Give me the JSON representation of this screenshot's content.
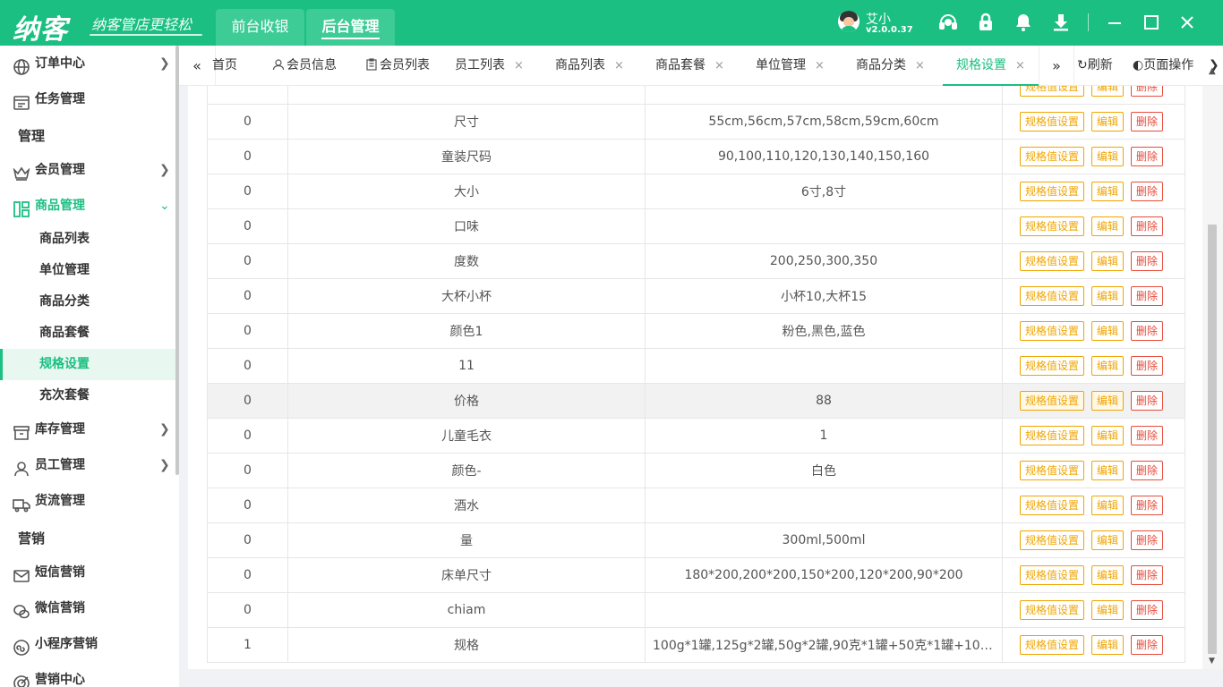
{
  "header": {
    "logo": "纳客",
    "slogan": "纳客管店更轻松",
    "tabs": [
      {
        "label": "前台收银"
      },
      {
        "label": "后台管理"
      }
    ],
    "user_name": "艾小",
    "version": "v2.0.0.37",
    "icons": [
      "headset-icon",
      "lock-icon",
      "bell-icon",
      "download-icon",
      "minimize-icon",
      "maximize-icon",
      "close-icon"
    ]
  },
  "sidebar": {
    "items": [
      {
        "label": "订单中心"
      },
      {
        "label": "任务管理"
      },
      {
        "group": "管理"
      },
      {
        "label": "会员管理"
      },
      {
        "label": "商品管理"
      },
      {
        "label": "库存管理"
      },
      {
        "label": "员工管理"
      },
      {
        "label": "货流管理"
      },
      {
        "group": "营销"
      },
      {
        "label": "短信营销"
      },
      {
        "label": "微信营销"
      },
      {
        "label": "小程序营销"
      },
      {
        "label": "营销中心"
      }
    ],
    "sub_items": [
      {
        "label": "商品列表"
      },
      {
        "label": "单位管理"
      },
      {
        "label": "商品分类"
      },
      {
        "label": "商品套餐"
      },
      {
        "label": "规格设置"
      },
      {
        "label": "充次套餐"
      }
    ]
  },
  "tabbar": {
    "tabs": [
      {
        "label": "首页"
      },
      {
        "label": "会员信息"
      },
      {
        "label": "会员列表"
      },
      {
        "label": "员工列表"
      },
      {
        "label": "商品列表"
      },
      {
        "label": "商品套餐"
      },
      {
        "label": "单位管理"
      },
      {
        "label": "商品分类"
      },
      {
        "label": "规格设置"
      }
    ],
    "refresh": "刷新",
    "page_ops": "页面操作",
    "close_glyph": "×"
  },
  "table": {
    "actions": {
      "spec": "规格值设置",
      "edit": "编辑",
      "del": "删除"
    },
    "rows": [
      {
        "sort": "0",
        "name": "尺寸",
        "values": "55cm,56cm,57cm,58cm,59cm,60cm"
      },
      {
        "sort": "0",
        "name": "童装尺码",
        "values": "90,100,110,120,130,140,150,160"
      },
      {
        "sort": "0",
        "name": "大小",
        "values": "6寸,8寸"
      },
      {
        "sort": "0",
        "name": "口味",
        "values": ""
      },
      {
        "sort": "0",
        "name": "度数",
        "values": "200,250,300,350"
      },
      {
        "sort": "0",
        "name": "大杯小杯",
        "values": "小杯10,大杯15"
      },
      {
        "sort": "0",
        "name": "颜色1",
        "values": "粉色,黑色,蓝色"
      },
      {
        "sort": "0",
        "name": "11",
        "values": ""
      },
      {
        "sort": "0",
        "name": "价格",
        "values": "88"
      },
      {
        "sort": "0",
        "name": "儿童毛衣",
        "values": "1"
      },
      {
        "sort": "0",
        "name": "颜色-",
        "values": "白色"
      },
      {
        "sort": "0",
        "name": "酒水",
        "values": ""
      },
      {
        "sort": "0",
        "name": "量",
        "values": "300ml,500ml"
      },
      {
        "sort": "0",
        "name": "床单尺寸",
        "values": "180*200,200*200,150*200,120*200,90*200"
      },
      {
        "sort": "0",
        "name": "chiam",
        "values": ""
      },
      {
        "sort": "1",
        "name": "规格",
        "values": "100g*1罐,125g*2罐,50g*2罐,90克*1罐+50克*1罐+10克*1..."
      }
    ]
  },
  "colors": {
    "brand": "#1bbf82",
    "warning": "#f0a500",
    "danger": "#e74c3c"
  }
}
